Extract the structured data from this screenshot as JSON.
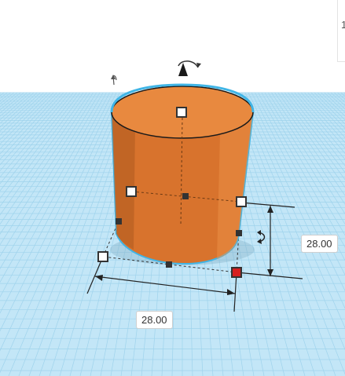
{
  "workplane": {
    "grid_color": "#bfe3f5",
    "grid_line_color": "#8ec9e6"
  },
  "shape": {
    "type": "cylinder",
    "fill": "#e2823a",
    "selection_outline": "#40b5e6"
  },
  "dimensions": {
    "height": "28.00",
    "width": "28.00"
  },
  "handles": {
    "corner_color": "#ffffff",
    "selected_corner_color": "#d61f1f",
    "edge_color": "#333333"
  },
  "icons": {
    "rotate_top": "rotate-arrow-icon",
    "rotate_side": "rotate-arrow-icon",
    "lift": "lift-arrow-icon"
  },
  "side_panel": {
    "glyph": "1"
  }
}
